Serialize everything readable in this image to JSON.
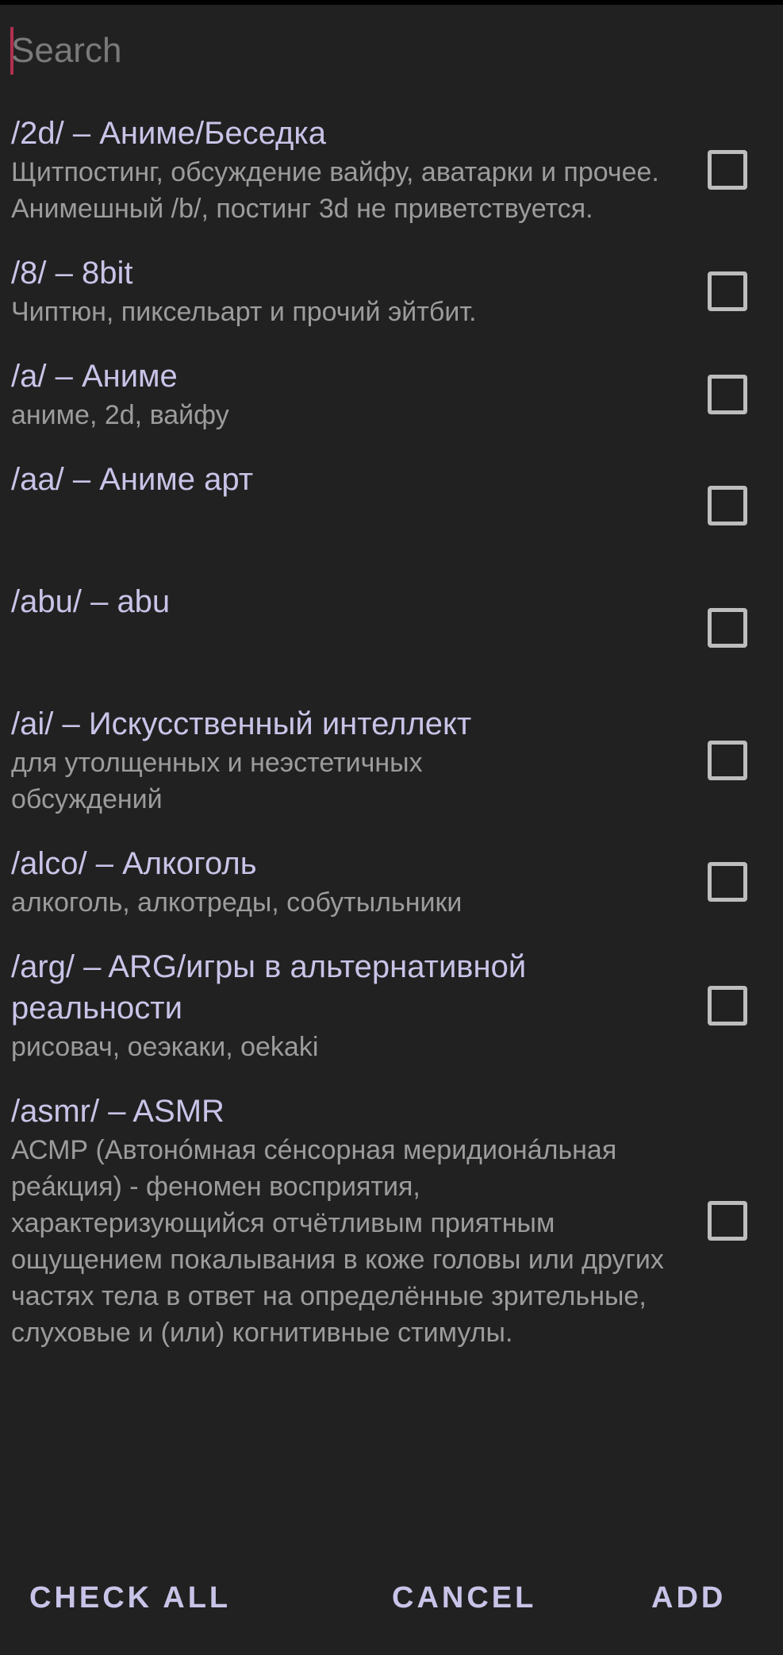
{
  "search": {
    "placeholder": "Search",
    "value": ""
  },
  "boards": [
    {
      "title": "/2d/ – Аниме/Беседка",
      "description": "Щитпостинг, обсуждение вайфу, аватарки и прочее. Анимешный /b/, постинг 3d не приветствуется.",
      "checked": false
    },
    {
      "title": "/8/ – 8bit",
      "description": "Чиптюн, пиксельарт и прочий эйтбит.",
      "checked": false
    },
    {
      "title": "/a/ – Аниме",
      "description": "аниме, 2d, вайфу",
      "checked": false
    },
    {
      "title": "/aa/ – Аниме арт",
      "description": "",
      "checked": false
    },
    {
      "title": "/abu/ – abu",
      "description": "",
      "checked": false
    },
    {
      "title": "/ai/ – Искусственный интеллект",
      "description": "для утолщенных и неэстетичных обсуждений",
      "checked": false
    },
    {
      "title": "/alco/ – Алкоголь",
      "description": "алкоголь, алкотреды, собутыльники",
      "checked": false
    },
    {
      "title": "/arg/ – ARG/игры в альтернативной реальности",
      "description": "рисовач, оеэкаки, oekaki",
      "checked": false
    },
    {
      "title": "/asmr/ – ASMR",
      "description": "АСМР (Автонóмная сéнсорная меридионáльная реáкция) - феномен восприятия, характеризующийся отчётливым приятным ощущением покалывания в коже головы или других частях тела в ответ на определённые зрительные, слуховые и (или) когнитивные стимулы.",
      "checked": false
    }
  ],
  "footer": {
    "check_all_label": "CHECK ALL",
    "cancel_label": "CANCEL",
    "add_label": "ADD"
  },
  "colors": {
    "background": "#212121",
    "title_text": "#c8c4e8",
    "description_text": "#9c9c9c",
    "caret": "#b0304f",
    "checkbox_border": "#bdbdbd"
  }
}
